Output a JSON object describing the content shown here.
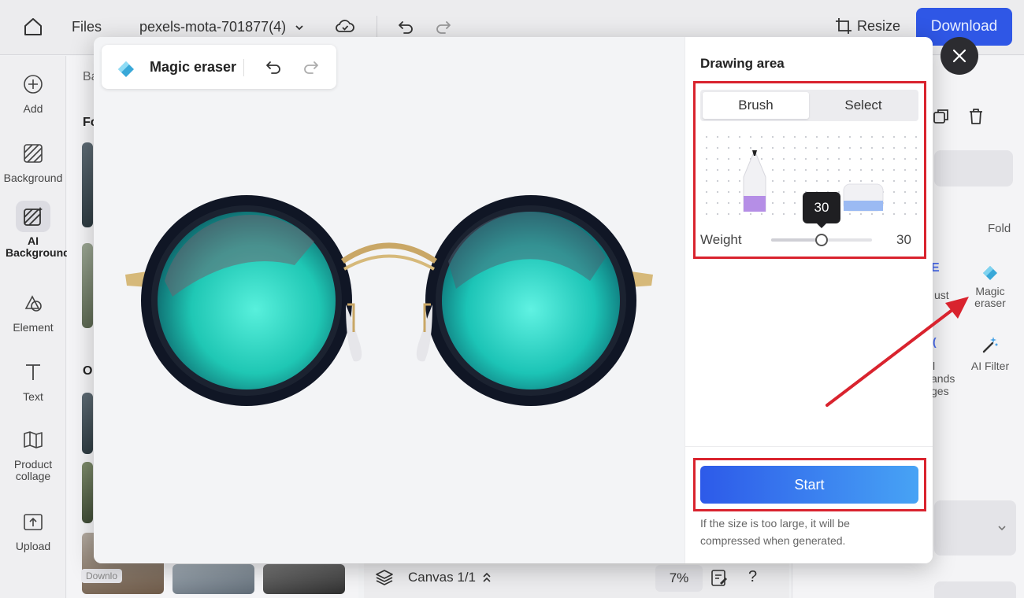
{
  "topbar": {
    "files_label": "Files",
    "filename": "pexels-mota-701877(4)",
    "resize_label": "Resize",
    "download_label": "Download"
  },
  "sidebar": {
    "items": [
      {
        "label": "Add",
        "icon": "plus-circle-icon"
      },
      {
        "label": "Background",
        "icon": "hatch-icon"
      },
      {
        "label": "AI Background",
        "icon": "ai-hatch-icon",
        "active": true
      },
      {
        "label": "Element",
        "icon": "shapes-icon"
      },
      {
        "label": "Text",
        "icon": "text-icon"
      },
      {
        "label": "Product collage",
        "icon": "map-icon"
      },
      {
        "label": "Upload",
        "icon": "upload-icon"
      }
    ]
  },
  "bg_panel": {
    "tab_fragment": "Ba",
    "section1_fragment": "Fo",
    "section2_fragment": "O",
    "tag_fragment": "Downlo"
  },
  "canvasbar": {
    "canvas_label": "Canvas 1/1",
    "zoom": "7%",
    "help": "?"
  },
  "right_panel": {
    "fold_label": "Fold",
    "tools": [
      {
        "label": "Magic eraser",
        "icon": "magic-eraser-icon"
      },
      {
        "label": "AI Filter",
        "icon": "magic-wand-icon"
      }
    ],
    "fragments": [
      "ust",
      "l",
      "ands",
      "ges"
    ]
  },
  "modal": {
    "title": "Magic eraser",
    "drawing_area_title": "Drawing area",
    "modes": {
      "brush": "Brush",
      "select": "Select",
      "active": "brush"
    },
    "weight": {
      "label": "Weight",
      "value": 30,
      "min": 0,
      "max": 60
    },
    "start_label": "Start",
    "note": "If the size is too large, it will be compressed when generated."
  },
  "colors": {
    "accent": "#2f57e6",
    "highlight": "#d9232e",
    "lens": "#2fe0c8"
  }
}
